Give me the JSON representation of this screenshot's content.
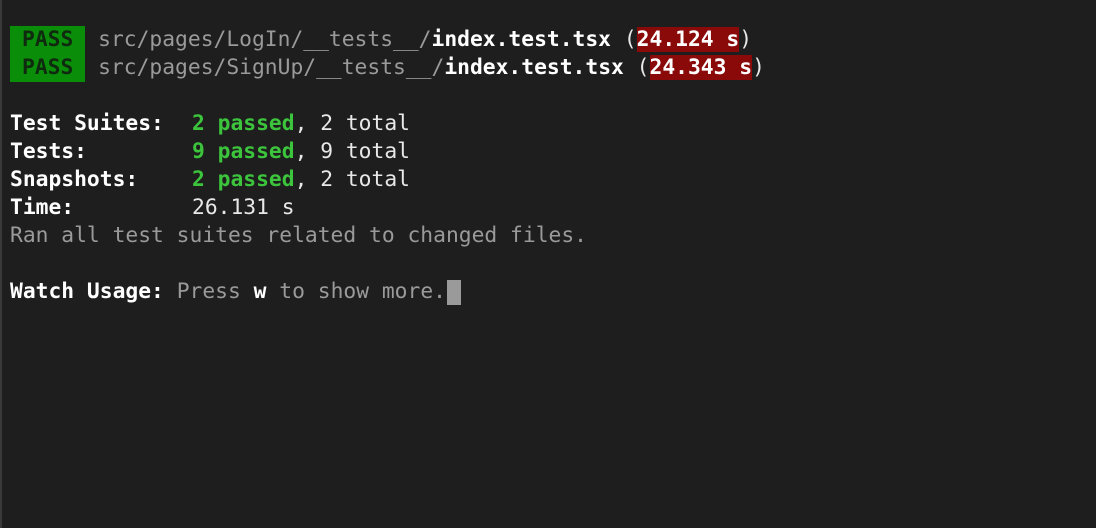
{
  "results": [
    {
      "status": "PASS",
      "path_dim": "src/pages/LogIn/__tests__/",
      "file": "index.test.tsx",
      "open_paren": "(",
      "time": "24.124 s",
      "close_paren": ")"
    },
    {
      "status": "PASS",
      "path_dim": "src/pages/SignUp/__tests__/",
      "file": "index.test.tsx",
      "open_paren": "(",
      "time": "24.343 s",
      "close_paren": ")"
    }
  ],
  "summary": {
    "suites": {
      "label": "Test Suites:",
      "passed": "2 passed",
      "rest": ", 2 total"
    },
    "tests": {
      "label": "Tests:",
      "passed": "9 passed",
      "rest": ", 9 total"
    },
    "snapshots": {
      "label": "Snapshots:",
      "passed": "2 passed",
      "rest": ", 2 total"
    },
    "time": {
      "label": "Time:",
      "value": "26.131 s"
    },
    "ran_note": "Ran all test suites related to changed files."
  },
  "watch": {
    "label": "Watch Usage:",
    "press": " Press ",
    "key": "w",
    "rest": " to show more."
  },
  "colors": {
    "background": "#1e1e1e",
    "pass_badge": "#0a8e0a",
    "time_highlight": "#8a0a0a",
    "passed_text": "#3cc43c",
    "dim_text": "#9a9a9a"
  }
}
